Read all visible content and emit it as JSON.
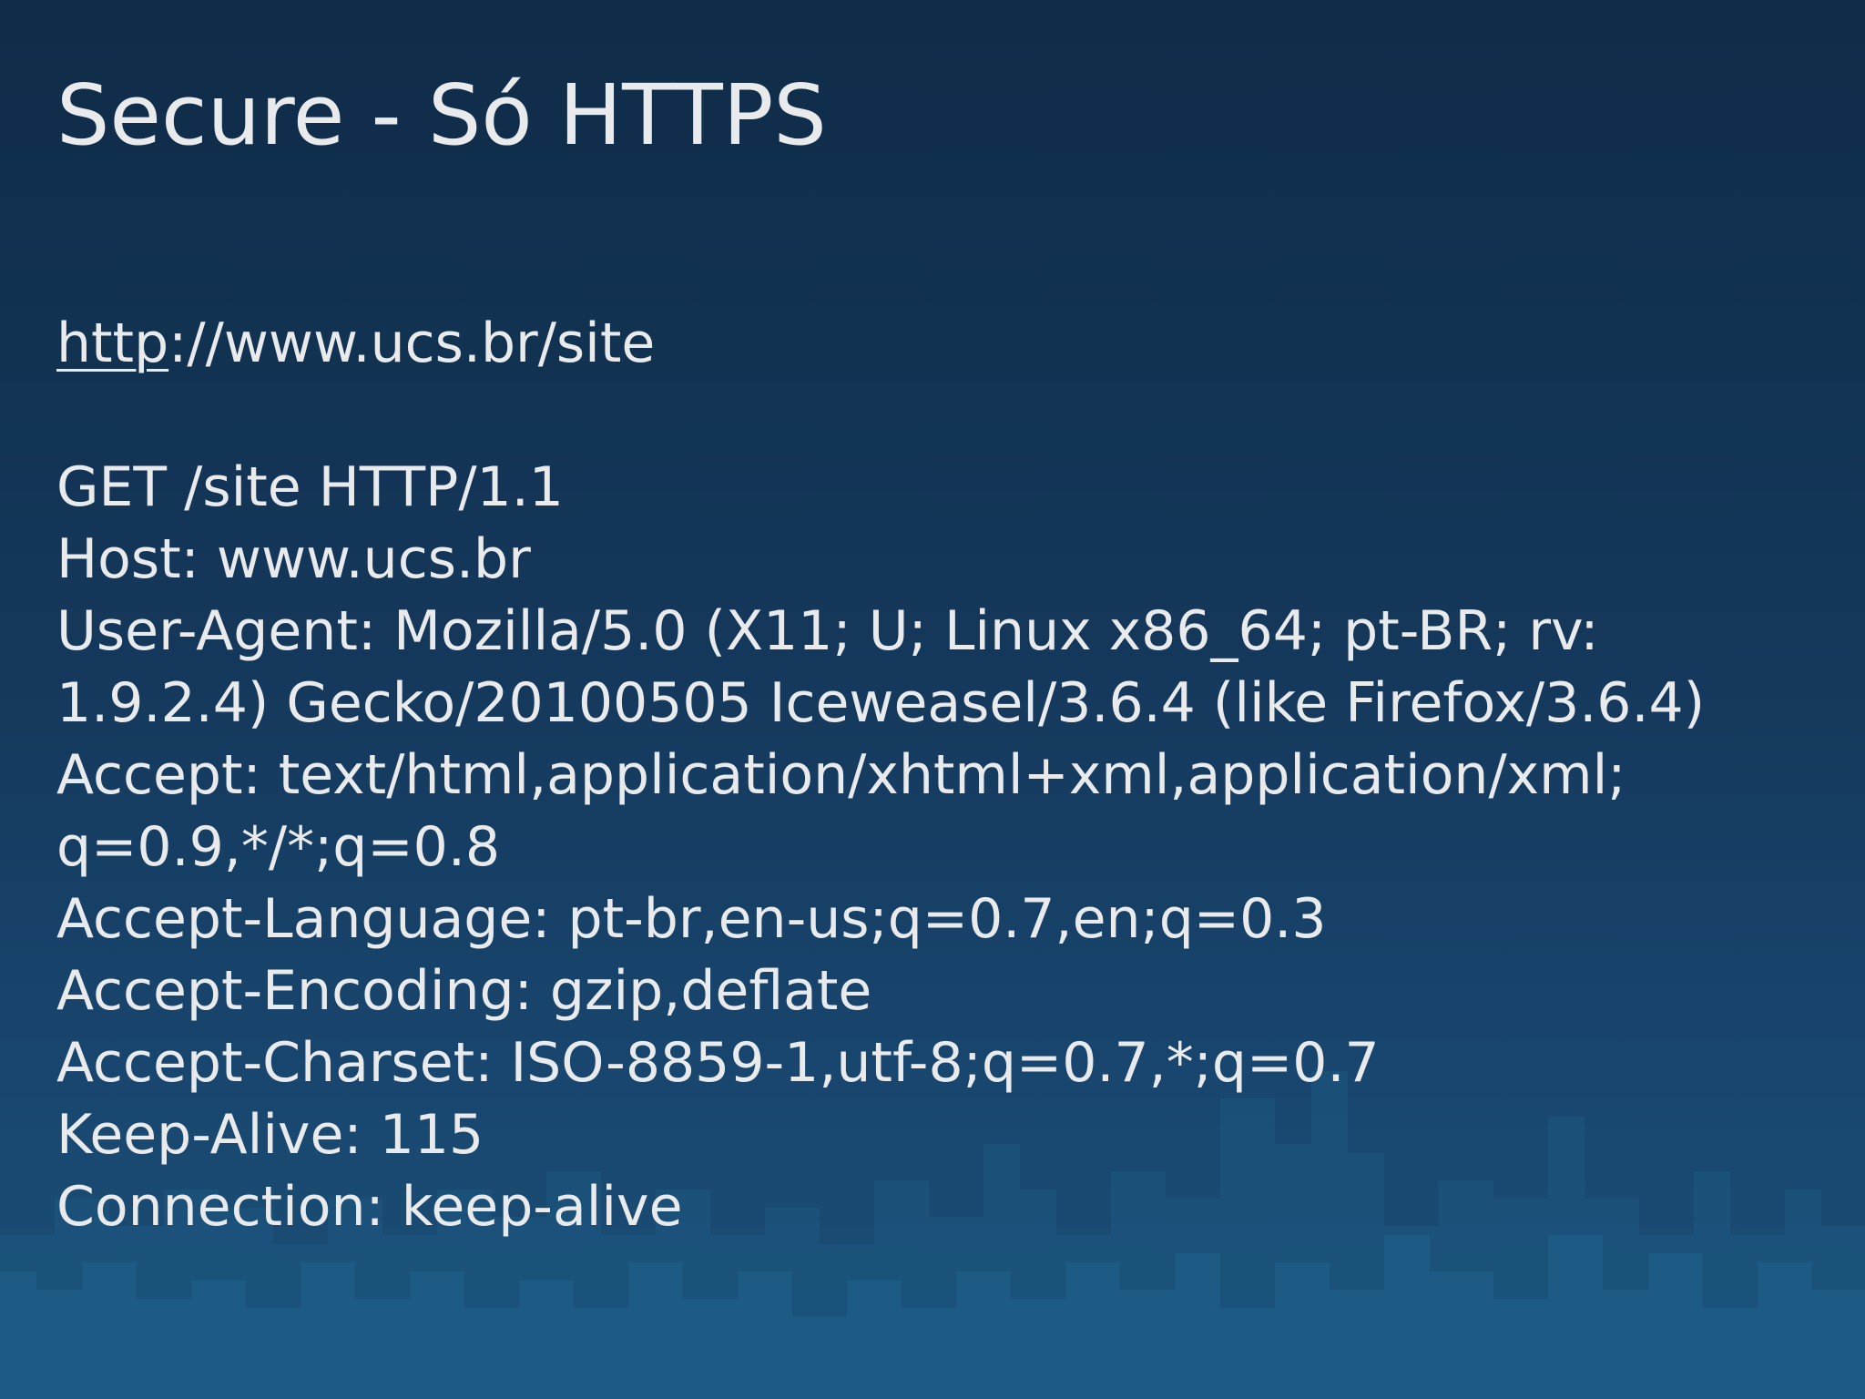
{
  "slide": {
    "title": "Secure - Só HTTPS",
    "url": {
      "scheme": "http",
      "rest": "://www.ucs.br/site"
    },
    "request_lines": [
      "GET /site HTTP/1.1",
      "Host: www.ucs.br",
      "User-Agent: Mozilla/5.0 (X11; U; Linux x86_64; pt-BR; rv:",
      "1.9.2.4) Gecko/20100505 Iceweasel/3.6.4 (like Firefox/3.6.4)",
      "Accept: text/html,application/xhtml+xml,application/xml;",
      "q=0.9,*/*;q=0.8",
      "Accept-Language: pt-br,en-us;q=0.7,en;q=0.3",
      "Accept-Encoding: gzip,deflate",
      "Accept-Charset: ISO-8859-1,utf-8;q=0.7,*;q=0.7",
      "Keep-Alive: 115",
      "Connection: keep-alive"
    ]
  },
  "colors": {
    "background_top": "#0f2c48",
    "background_bottom": "#1b5078",
    "skyline": "#1f5a80",
    "text": "#e8eaec"
  }
}
